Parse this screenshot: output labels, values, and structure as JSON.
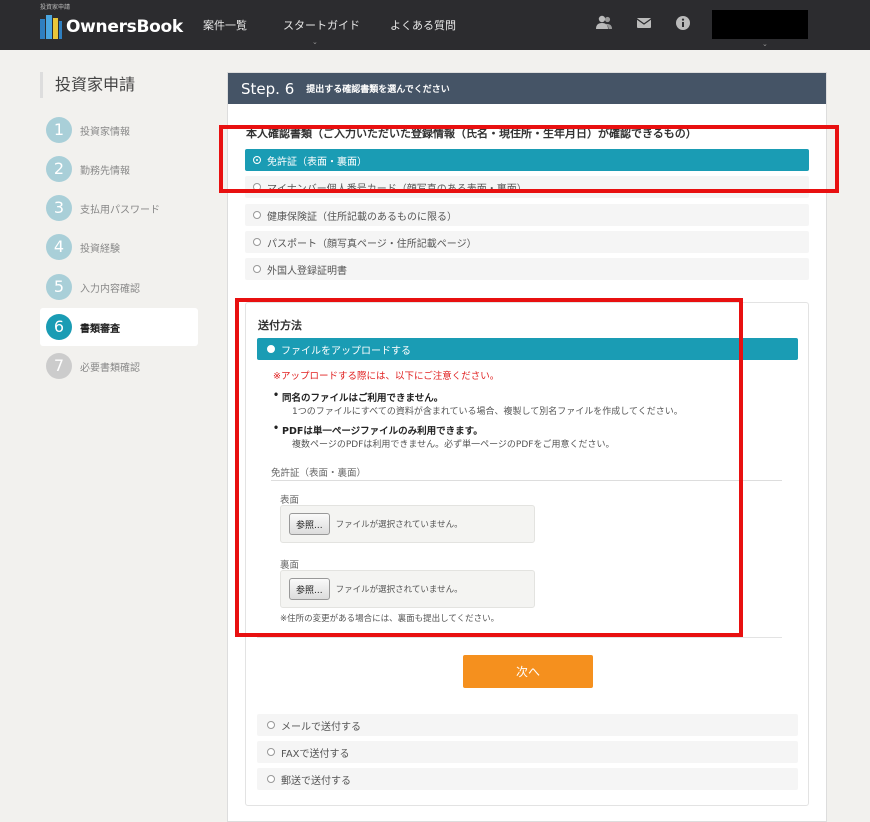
{
  "header": {
    "brand_small": "投資家申請",
    "logo_text": "OwnersBook",
    "nav": [
      {
        "label": "案件一覧"
      },
      {
        "label": "スタートガイド"
      },
      {
        "label": "よくある質問"
      }
    ],
    "icons": [
      "users-icon",
      "mail-icon",
      "info-icon"
    ]
  },
  "sidebar": {
    "title": "投資家申請",
    "steps": [
      {
        "num": "1",
        "label": "投資家情報"
      },
      {
        "num": "2",
        "label": "勤務先情報"
      },
      {
        "num": "3",
        "label": "支払用パスワード"
      },
      {
        "num": "4",
        "label": "投資経験"
      },
      {
        "num": "5",
        "label": "入力内容確認"
      },
      {
        "num": "6",
        "label": "書類審査"
      },
      {
        "num": "7",
        "label": "必要書類確認"
      }
    ],
    "active_step": 6
  },
  "main": {
    "step_label": "Step. 6",
    "step_title": "提出する確認書類を選んでください",
    "doc_heading": "本人確認書類（ご入力いただいた登録情報（氏名・現住所・生年月日）が確認できるもの）",
    "doc_options": [
      {
        "label": "免許証（表面・裏面）",
        "selected": true
      },
      {
        "label": "マイナンバー個人番号カード（顔写真のある表面・裏面）",
        "selected": false
      },
      {
        "label": "健康保険証（住所記載のあるものに限る）",
        "selected": false
      },
      {
        "label": "パスポート（顔写真ページ・住所記載ページ）",
        "selected": false
      },
      {
        "label": "外国人登録証明書",
        "selected": false
      }
    ],
    "send": {
      "title": "送付方法",
      "upload_option": "ファイルをアップロードする",
      "warning": "※アップロードする際には、以下にご注意ください。",
      "bullet1": "同名のファイルはご利用できません。",
      "bullet1_sub": "1つのファイルにすべての資料が含まれている場合、複製して別名ファイルを作成してください。",
      "bullet2": "PDFは単一ページファイルのみ利用できます。",
      "bullet2_sub": "複数ページのPDFは利用できません。必ず単一ページのPDFをご用意ください。",
      "group_title": "免許証（表面・裏面）",
      "front_label": "表面",
      "back_label": "裏面",
      "browse_label": "参照...",
      "no_file_text": "ファイルが選択されていません。",
      "note": "※住所の変更がある場合には、裏面も提出してください。",
      "next_label": "次へ",
      "other_options": [
        {
          "label": "メールで送付する"
        },
        {
          "label": "FAXで送付する"
        },
        {
          "label": "郵送で送付する"
        }
      ]
    }
  },
  "colors": {
    "header_bg": "#2c2c2f",
    "accent": "#1a9cb4",
    "panel_head": "#455466",
    "next_button": "#f5901e",
    "warning": "#e02020",
    "annotation": "#e81010"
  }
}
